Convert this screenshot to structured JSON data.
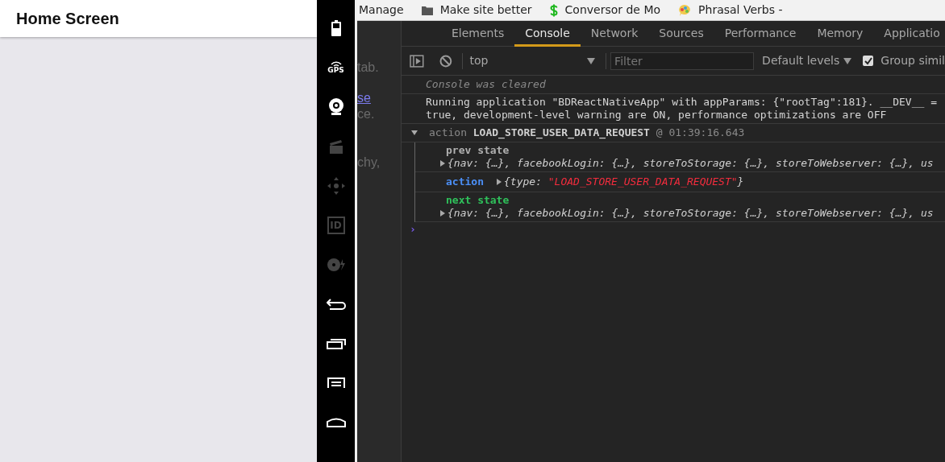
{
  "app_screen": {
    "title": "Home Screen"
  },
  "emulator_toolbar": [
    {
      "kind": "battery",
      "disabled": false
    },
    {
      "kind": "gps",
      "label": "GPS",
      "disabled": false
    },
    {
      "kind": "camera",
      "disabled": false
    },
    {
      "kind": "clapper",
      "disabled": true
    },
    {
      "kind": "dpad",
      "disabled": true
    },
    {
      "kind": "id",
      "label": "ID",
      "disabled": true
    },
    {
      "kind": "disc",
      "disabled": true
    },
    {
      "kind": "back",
      "disabled": false
    },
    {
      "kind": "recent",
      "disabled": false
    },
    {
      "kind": "menu",
      "disabled": false
    },
    {
      "kind": "home",
      "disabled": false
    }
  ],
  "page_behind": [
    {
      "text": "tab.",
      "kind": "text"
    },
    {
      "text": "se",
      "kind": "link"
    },
    {
      "text": "ce.",
      "kind": "text"
    },
    {
      "text": "chy,",
      "kind": "text"
    }
  ],
  "bookmarks": [
    {
      "label": "Manage",
      "kind": "plain"
    },
    {
      "label": "Make site better",
      "kind": "folder"
    },
    {
      "label": "Conversor de Mo",
      "kind": "dollar"
    },
    {
      "label": "Phrasal Verbs -",
      "kind": "bubble"
    }
  ],
  "devtools": {
    "tabs": [
      {
        "label": "Elements",
        "selected": false
      },
      {
        "label": "Console",
        "selected": true
      },
      {
        "label": "Network",
        "selected": false
      },
      {
        "label": "Sources",
        "selected": false
      },
      {
        "label": "Performance",
        "selected": false
      },
      {
        "label": "Memory",
        "selected": false
      },
      {
        "label": "Applicatio",
        "selected": false
      }
    ],
    "toolbar": {
      "context": "top",
      "filter": {
        "placeholder": "Filter"
      },
      "levels": "Default levels",
      "group_similar": {
        "label": "Group simil",
        "checked": true
      }
    },
    "console": [
      {
        "kind": "info",
        "lines": [
          "Console was cleared"
        ]
      },
      {
        "kind": "log",
        "lines": [
          "Running application \"BDReactNativeApp\" with appParams: {\"rootTag\":181}. __DEV__ =",
          "true, development-level warning are ON, performance optimizations are OFF"
        ]
      },
      {
        "kind": "group",
        "expanded": true,
        "prefix": "action",
        "title": "LOAD_STORE_USER_DATA_REQUEST",
        "time": "@ 01:39:16.643",
        "entries": [
          {
            "label": "prev state",
            "color": "#b0b0b0",
            "kind": "stacked",
            "value": "{nav: {…}, facebookLogin: {…}, storeToStorage: {…}, storeToWebserver: {…}, us"
          },
          {
            "label": "action",
            "color": "#4b8ff7",
            "kind": "inline",
            "value_parts": [
              "{type: ",
              "\"LOAD_STORE_USER_DATA_REQUEST\"",
              "}"
            ]
          },
          {
            "label": "next state",
            "color": "#2fc25b",
            "kind": "stacked",
            "value": "{nav: {…}, facebookLogin: {…}, storeToStorage: {…}, storeToWebserver: {…}, us"
          }
        ]
      }
    ],
    "prompt": "›"
  }
}
